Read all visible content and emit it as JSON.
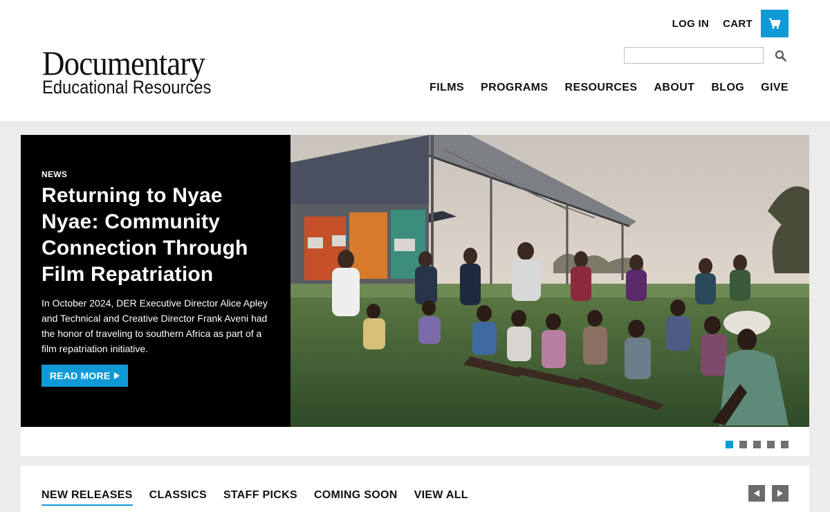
{
  "brand": {
    "line1": "Documentary",
    "line2": "Educational Resources"
  },
  "header": {
    "login_label": "LOG IN",
    "cart_label": "CART",
    "cart_icon": "cart-icon",
    "search_placeholder": "",
    "search_icon": "search-icon"
  },
  "nav": {
    "items": [
      {
        "label": "FILMS"
      },
      {
        "label": "PROGRAMS"
      },
      {
        "label": "RESOURCES"
      },
      {
        "label": "ABOUT"
      },
      {
        "label": "BLOG"
      },
      {
        "label": "GIVE"
      }
    ]
  },
  "hero": {
    "kicker": "NEWS",
    "title": "Returning to Nyae Nyae: Community Connection Through Film Repatriation",
    "description": "In October 2024, DER Executive Director Alice Apley and Technical and Creative Director Frank Aveni had the honor of traveling to southern Africa as part of a film repatriation initiative.",
    "button_label": "READ MORE",
    "slides_total": 5,
    "active_slide": 1
  },
  "tabs": {
    "items": [
      {
        "label": "NEW RELEASES",
        "active": true
      },
      {
        "label": "CLASSICS",
        "active": false
      },
      {
        "label": "STAFF PICKS",
        "active": false
      },
      {
        "label": "COMING SOON",
        "active": false
      },
      {
        "label": "VIEW ALL",
        "active": false
      }
    ]
  },
  "colors": {
    "accent": "#0f9ad6",
    "hero_bg": "#000000",
    "page_bg": "#ececec"
  }
}
